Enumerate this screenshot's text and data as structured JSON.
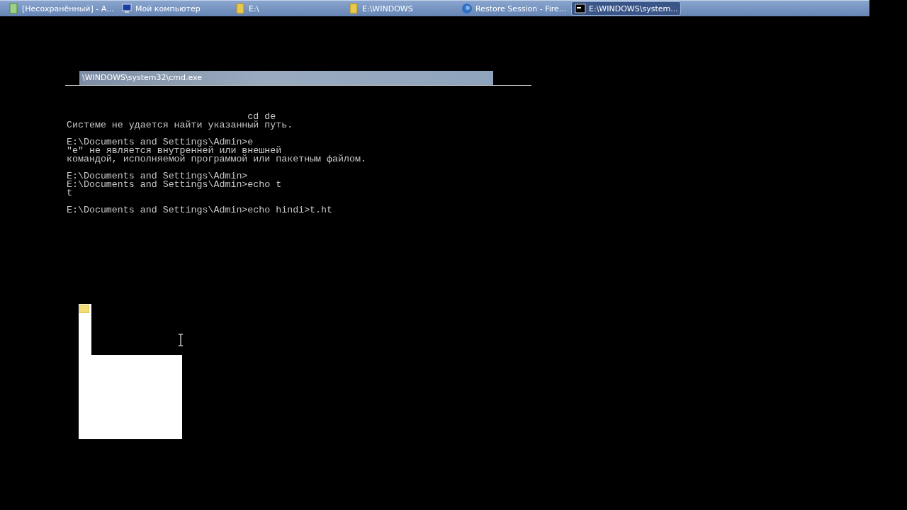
{
  "taskbar": {
    "tasks": [
      {
        "label": "[Несохранённый] - А...",
        "kind": "document",
        "selected": false
      },
      {
        "label": "Мой компьютер",
        "kind": "computer",
        "selected": false
      },
      {
        "label": "E:\\",
        "kind": "folder",
        "selected": false
      },
      {
        "label": "E:\\WINDOWS",
        "kind": "folder",
        "selected": false
      },
      {
        "label": "Restore Session - Fire...",
        "kind": "globe",
        "selected": false
      },
      {
        "label": "E:\\WINDOWS\\system...",
        "kind": "console",
        "selected": true
      }
    ]
  },
  "console": {
    "title": "\\WINDOWS\\system32\\cmd.exe",
    "blocks": [
      [
        {
          "kind": "indented",
          "text": "cd de"
        },
        {
          "kind": "line",
          "text": "Системе не удается найти указанный путь."
        }
      ],
      [
        {
          "kind": "line",
          "text": "E:\\Documents and Settings\\Admin>e"
        },
        {
          "kind": "line",
          "text": "\"e\" не является внутренней или внешней"
        },
        {
          "kind": "line",
          "text": "командой, исполняемой программой или пакетным файлом."
        }
      ],
      [
        {
          "kind": "line",
          "text": "E:\\Documents and Settings\\Admin>"
        },
        {
          "kind": "line",
          "text": "E:\\Documents and Settings\\Admin>echo t"
        },
        {
          "kind": "line",
          "text": "t"
        }
      ],
      [
        {
          "kind": "line",
          "text": "E:\\Documents and Settings\\Admin>echo hindi>t.ht"
        }
      ]
    ]
  }
}
